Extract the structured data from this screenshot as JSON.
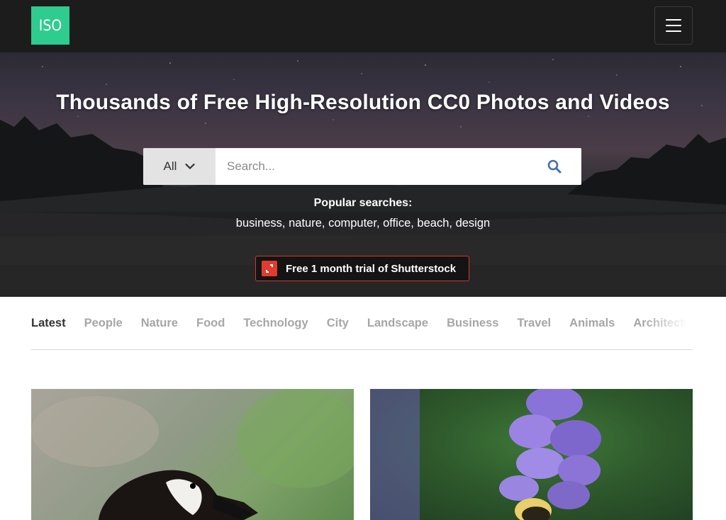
{
  "header": {
    "logo_text": "ISO",
    "menu_icon": "hamburger-icon",
    "brand_color": "#2ecc8e"
  },
  "hero": {
    "title": "Thousands of Free High-Resolution CC0 Photos and Videos",
    "search": {
      "category_selected": "All",
      "placeholder": "Search...",
      "value": "",
      "search_icon": "search-icon"
    },
    "popular_label": "Popular searches:",
    "popular_terms": [
      "business",
      "nature",
      "computer",
      "office",
      "beach",
      "design"
    ],
    "promo": {
      "label": "Free 1 month trial of Shutterstock",
      "icon": "shutterstock-icon",
      "accent_color": "#e23b2e"
    }
  },
  "tabs": {
    "items": [
      "Latest",
      "People",
      "Nature",
      "Food",
      "Technology",
      "City",
      "Landscape",
      "Business",
      "Travel",
      "Animals",
      "Architecture"
    ],
    "active": "Latest"
  },
  "photos": [
    {
      "subject": "canada-goose-photo"
    },
    {
      "subject": "bee-on-purple-flower-photo"
    }
  ]
}
